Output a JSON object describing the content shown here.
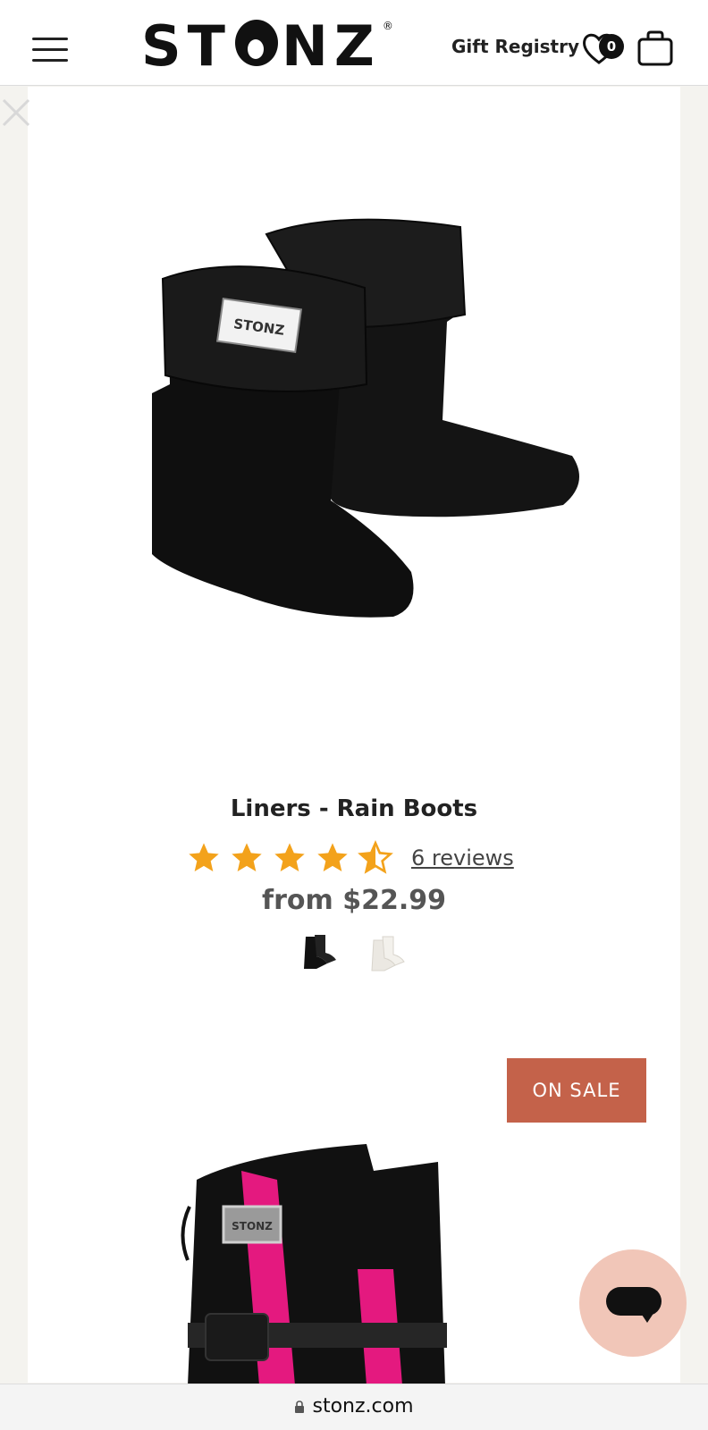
{
  "header": {
    "logo": "STONZ",
    "gift_registry": "Gift Registry",
    "wishlist_count": "0",
    "icons": [
      "menu-icon",
      "heart-icon",
      "cart-icon"
    ]
  },
  "product": {
    "title": "Liners - Rain Boots",
    "rating": 4.5,
    "rating_max": 5,
    "reviews_label": "6 reviews",
    "price": "from $22.99",
    "swatches": [
      "black",
      "white"
    ]
  },
  "next_product": {
    "badge": "ON SALE"
  },
  "browser": {
    "url": "stonz.com"
  },
  "colors": {
    "star": "#f3a21b",
    "sale_badge": "#c4624a",
    "chat_button": "#f1c6b8"
  }
}
